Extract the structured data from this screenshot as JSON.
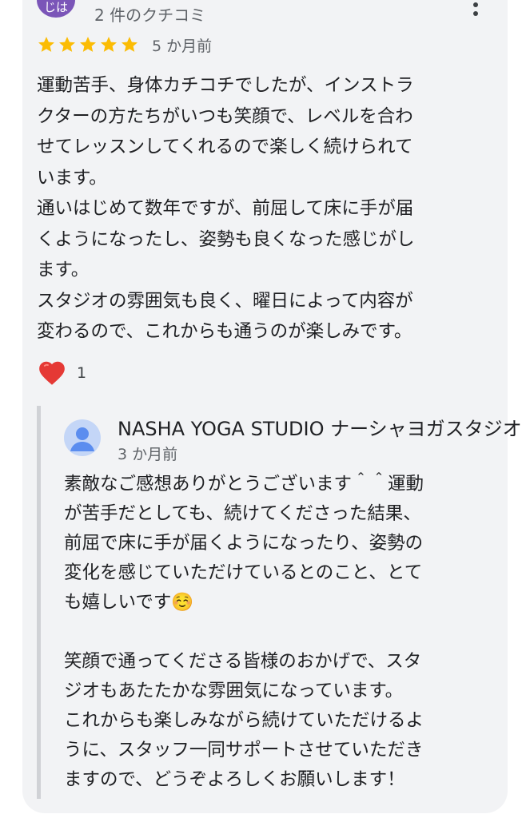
{
  "review": {
    "author_initials": "じは",
    "review_count": "2 件のクチコミ",
    "rating": 5,
    "rating_max": 5,
    "date": "5 か月前",
    "text": "運動苦手、身体カチコチでしたが、インストラ\nクターの方たちがいつも笑顔で、レベルを合わ\nせてレッスンしてくれるので楽しく続けられて\nいます。\n通いはじめて数年ですが、前屈して床に手が届\nくようになったし、姿勢も良くなった感じがし\nます。\nスタジオの雰囲気も良く、曜日によって内容が\n変わるので、これからも通うのが楽しみです。",
    "reaction_icon": "heart-icon",
    "reaction_count": "1"
  },
  "owner_reply": {
    "owner_name": "NASHA YOGA STUDIO ナーシャヨガスタジオ",
    "date": "3 か月前",
    "text": "素敵なご感想ありがとうございます＾＾運動\nが苦手だとしても、続けてくださった結果、\n前屈で床に手が届くようになったり、姿勢の\n変化を感じていただけているとのこと、とて\nも嬉しいです☺️\n\n笑顔で通ってくださる皆様のおかげで、スタ\nジオもあたたかな雰囲気になっています。\nこれからも楽しみながら続けていただけるよ\nうに、スタッフ一同サポートさせていただき\nますので、どうぞよろしくお願いします！"
  },
  "colors": {
    "card_background": "#f2f3f5",
    "star": "#fbbc04",
    "heart": "#e53935",
    "avatar_purple": "#7b55b8",
    "owner_avatar": "#c4d6f7",
    "secondary_text": "#5f6368"
  }
}
